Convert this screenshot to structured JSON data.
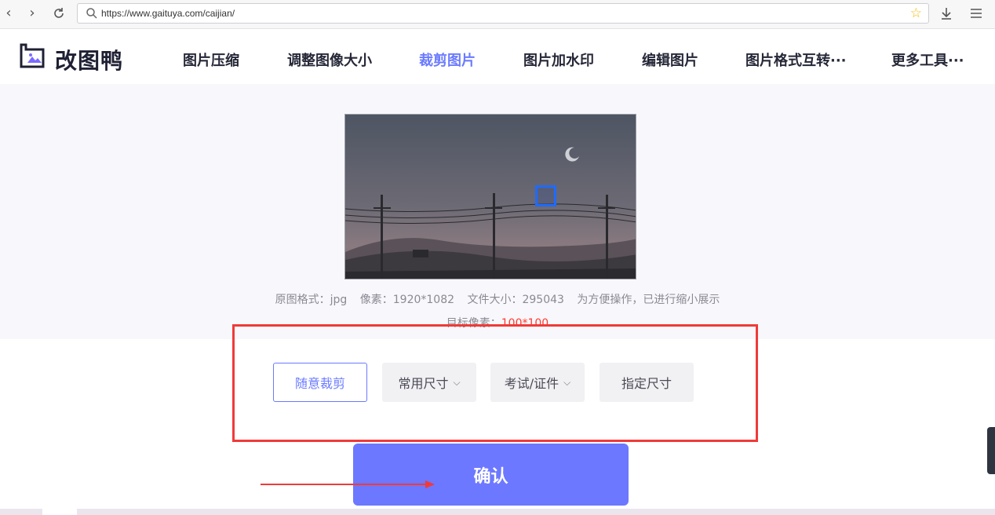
{
  "browser": {
    "url": "https://www.gaituya.com/caijian/",
    "icons": [
      "back-arrow-icon",
      "forward-arrow-icon",
      "reload-icon",
      "search-icon",
      "bookmark-star-icon",
      "download-icon",
      "menu-icon"
    ]
  },
  "site": {
    "logo_text": "改图鸭",
    "nav": [
      {
        "label": "图片压缩"
      },
      {
        "label": "调整图像大小"
      },
      {
        "label": "裁剪图片",
        "active": true
      },
      {
        "label": "图片加水印"
      },
      {
        "label": "编辑图片"
      },
      {
        "label": "图片格式互转···"
      },
      {
        "label": "更多工具···"
      }
    ],
    "accent_color": "#6b7bff"
  },
  "image_info": {
    "format_label": "原图格式：jpg",
    "pixels_label": "像素：1920*1082",
    "size_label": "文件大小：295043",
    "note": "为方便操作，已进行缩小展示",
    "target_label": "目标像素：",
    "target_value": "100*100"
  },
  "options": {
    "free_crop": "随意裁剪",
    "common_size": "常用尺寸",
    "exam_id": "考试/证件",
    "custom_size": "指定尺寸"
  },
  "confirm_label": "确认",
  "colors": {
    "highlight_box": "#f03a3a",
    "confirm_bg": "#6c78ff",
    "target_value": "#ff3b30"
  }
}
